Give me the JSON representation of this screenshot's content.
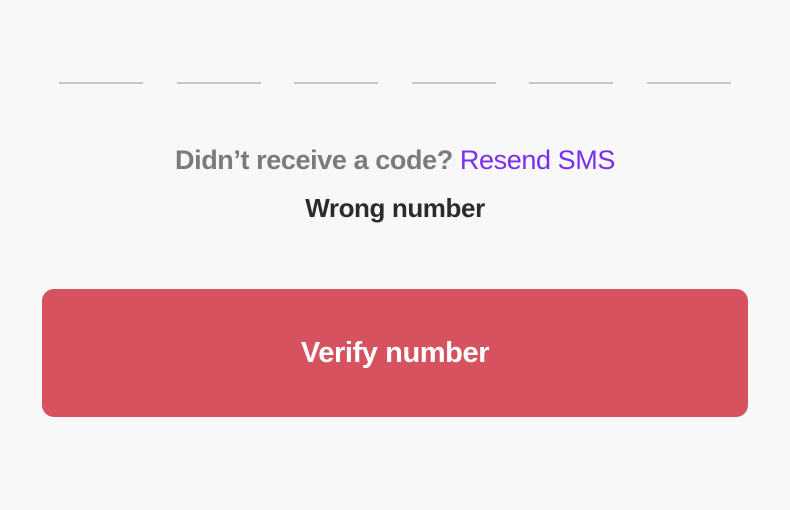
{
  "code_input": {
    "digits": [
      "",
      "",
      "",
      "",
      "",
      ""
    ]
  },
  "resend": {
    "prompt": "Didn’t receive a code?",
    "link_label": "Resend SMS"
  },
  "wrong_number_label": "Wrong number",
  "verify_button_label": "Verify number",
  "colors": {
    "background": "#f8f8f8",
    "slot_underline": "#c9c9c9",
    "prompt_text": "#7b7b7b",
    "link_accent": "#7a2ef0",
    "wrong_number_text": "#2b2b2b",
    "button_background": "#d6525e",
    "button_text": "#ffffff"
  }
}
